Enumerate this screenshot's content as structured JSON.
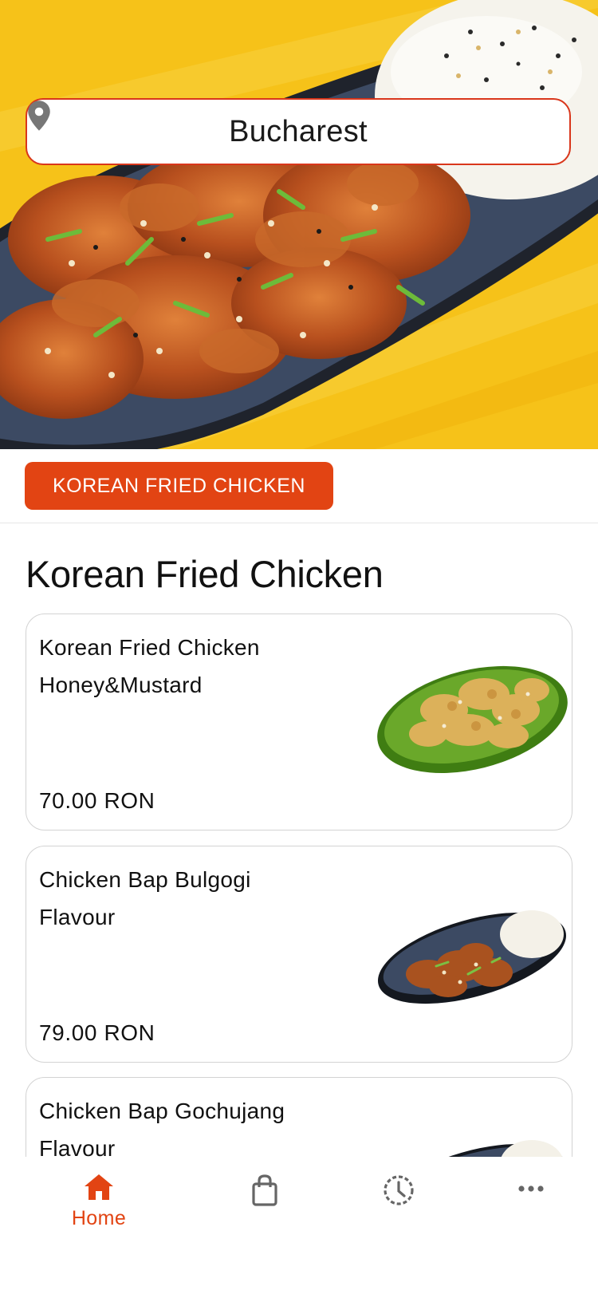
{
  "header": {
    "location": "Bucharest",
    "location_icon": "map-pin-icon"
  },
  "categories": [
    {
      "label": "KOREAN FRIED CHICKEN",
      "active": true
    }
  ],
  "section": {
    "title": "Korean Fried Chicken",
    "items": [
      {
        "name": "Korean Fried Chicken Honey&Mustard",
        "price": "70.00 RON"
      },
      {
        "name": "Chicken Bap Bulgogi Flavour",
        "price": "79.00 RON"
      },
      {
        "name": "Chicken Bap Gochujang Flavour",
        "price": ""
      }
    ]
  },
  "nav": {
    "items": [
      {
        "label": "Home",
        "icon": "home-icon",
        "active": true
      },
      {
        "label": "",
        "icon": "shopping-bag-icon",
        "active": false
      },
      {
        "label": "",
        "icon": "history-clock-icon",
        "active": false
      },
      {
        "label": "",
        "icon": "more-dots-icon",
        "active": false
      }
    ]
  },
  "colors": {
    "accent": "#e24413",
    "hero_background": "#f6c219",
    "pill_border": "#d9361b"
  }
}
